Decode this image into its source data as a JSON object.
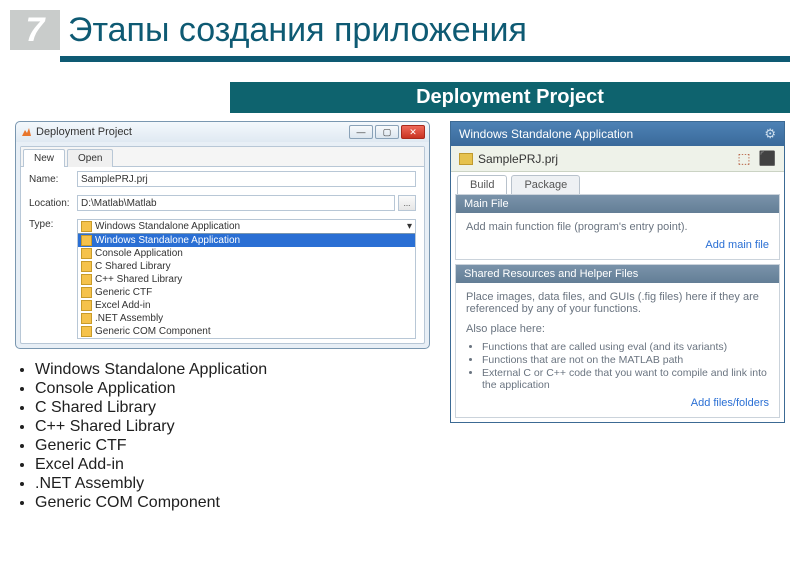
{
  "page_number": "7",
  "title": "Этапы создания приложения",
  "banner": "Deployment Project",
  "left_dialog": {
    "window_title": "Deployment Project",
    "tab_new": "New",
    "tab_open": "Open",
    "label_name": "Name:",
    "label_location": "Location:",
    "label_type": "Type:",
    "name_value": "SamplePRJ.prj",
    "location_value": "D:\\Matlab\\Matlab",
    "browse": "...",
    "selected_type": "Windows Standalone Application",
    "dropdown_caret": "▾",
    "types": [
      "Windows Standalone Application",
      "Console Application",
      "C Shared Library",
      "C++ Shared Library",
      "Generic CTF",
      "Excel Add-in",
      ".NET Assembly",
      "Generic COM Component"
    ]
  },
  "right_panel": {
    "window_title": "Windows Standalone Application",
    "project_file": "SamplePRJ.prj",
    "tab_build": "Build",
    "tab_package": "Package",
    "section1_title": "Main File",
    "section1_text": "Add main function file (program's entry point).",
    "section1_link": "Add main file",
    "section2_title": "Shared Resources and Helper Files",
    "section2_text": "Place images, data files, and GUIs (.fig files) here if they are referenced by any of your functions.",
    "section2_also": "Also place here:",
    "section2_items": [
      "Functions that are called using eval (and its variants)",
      "Functions that are not on the MATLAB path",
      "External C or C++ code that you want to compile and link into the application"
    ],
    "section2_link": "Add files/folders"
  },
  "bullet_items": [
    "Windows Standalone Application",
    "Console Application",
    "C Shared Library",
    "C++ Shared Library",
    "Generic CTF",
    "Excel Add-in",
    ".NET Assembly",
    "Generic COM Component"
  ]
}
